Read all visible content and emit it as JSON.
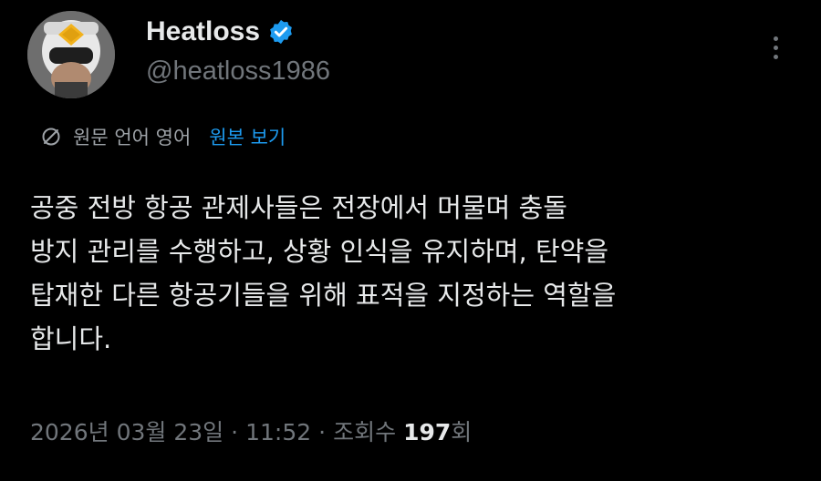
{
  "author": {
    "display_name": "Heatloss",
    "handle": "@heatloss1986",
    "verified": true,
    "avatar_icon": "pilot-helmet-avatar"
  },
  "translation": {
    "icon": "translate-icon",
    "label": "원문 언어 영어",
    "show_original_label": "원본 보기"
  },
  "tweet": {
    "lines": [
      "공중 전방 항공 관제사들은 전장에서 머물며 충돌",
      "방지 관리를 수행하고, 상황 인식을 유지하며, 탄약을",
      "탑재한 다른 항공기들을 위해 표적을 지정하는 역할을",
      "합니다."
    ]
  },
  "meta": {
    "date": "2026년 03월 23일",
    "separator": "·",
    "time": "11:52",
    "views_label": "조회수",
    "views_count": "197",
    "views_unit": "회"
  },
  "colors": {
    "background": "#000000",
    "text": "#e7e9ea",
    "secondary": "#71767b",
    "accent": "#1d9bf0"
  }
}
